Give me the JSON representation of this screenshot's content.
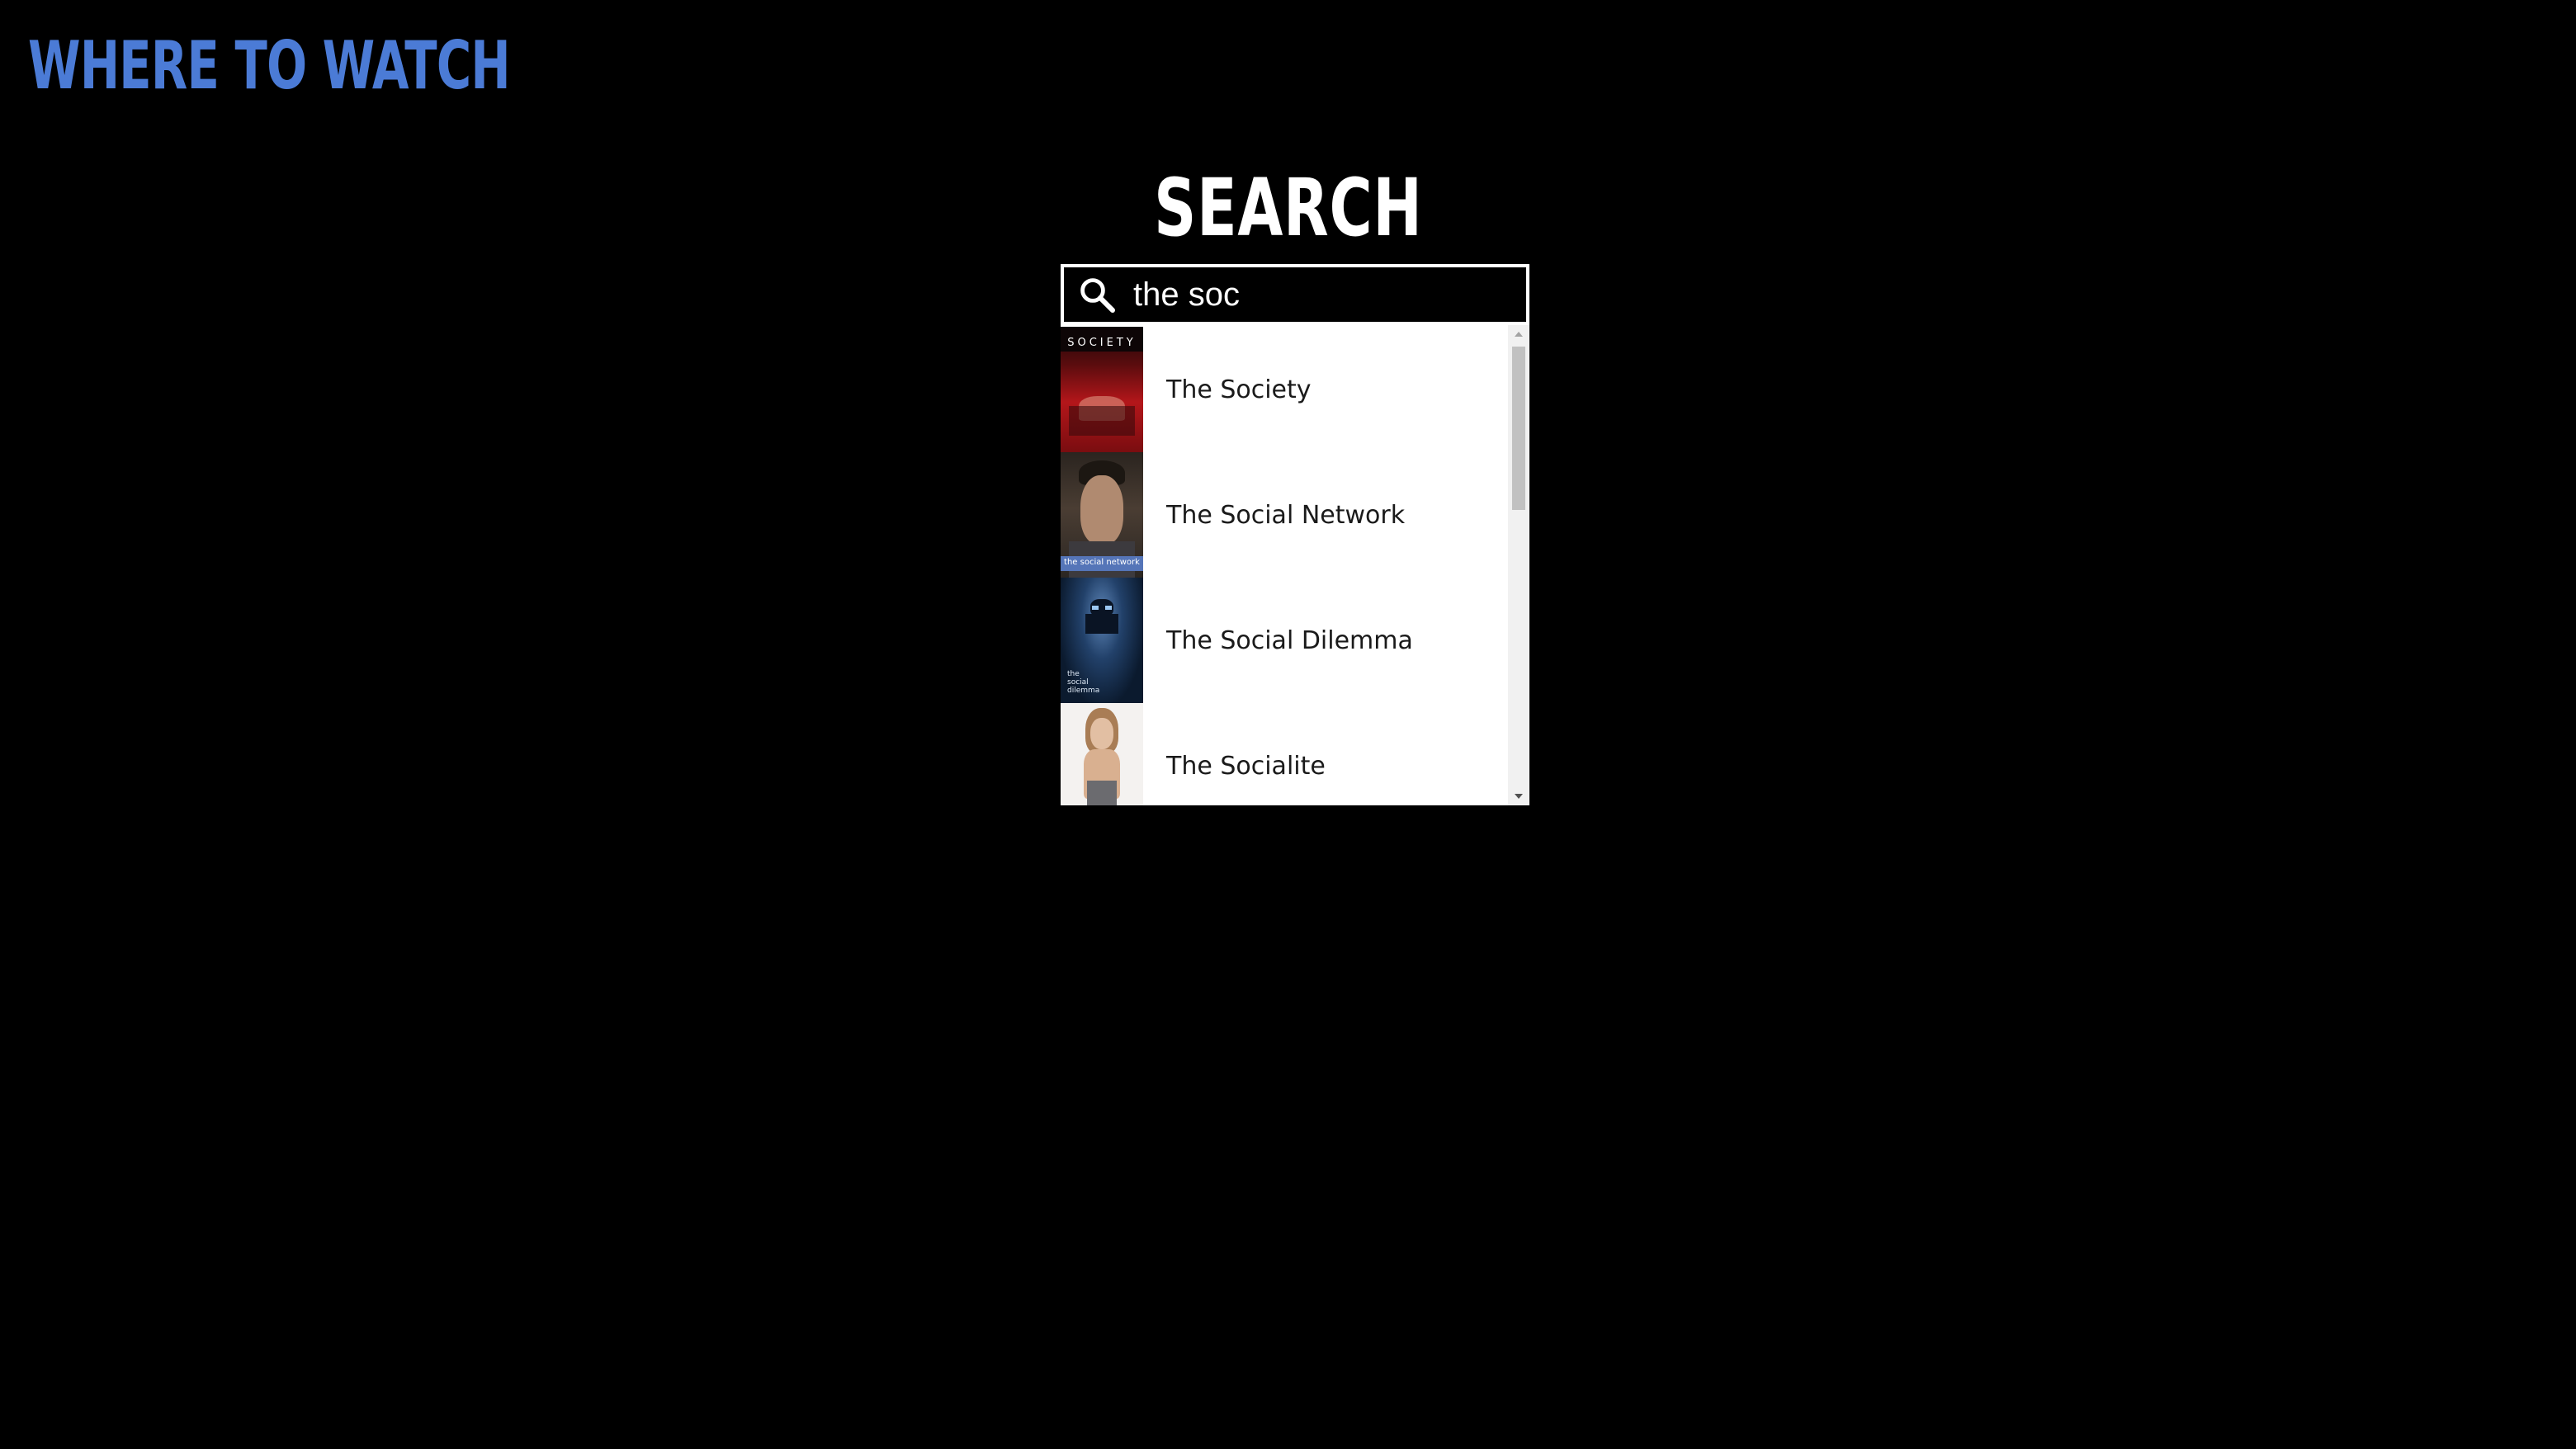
{
  "header": {
    "logo_text": "WHERE TO WATCH",
    "logo_color": "#4b7bd6"
  },
  "main": {
    "title": "SEARCH"
  },
  "search": {
    "value": "the soc",
    "icon": "search-icon"
  },
  "results": [
    {
      "title": "The Society",
      "poster_text": "SOCIETY"
    },
    {
      "title": "The Social Network",
      "poster_text": "the social network"
    },
    {
      "title": "The Social Dilemma",
      "poster_text": "the social dilemma"
    },
    {
      "title": "The Socialite"
    }
  ]
}
